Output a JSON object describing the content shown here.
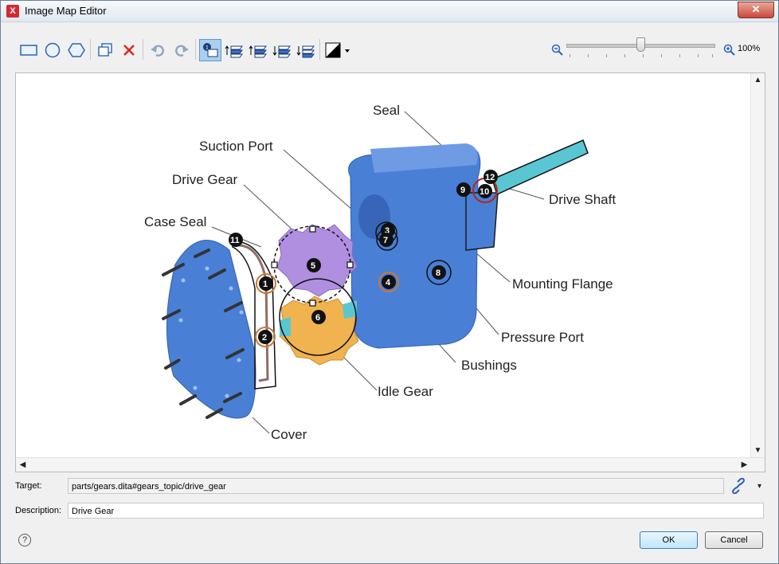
{
  "window": {
    "title": "Image Map Editor"
  },
  "toolbar": {
    "tools": [
      "rectangle-tool",
      "circle-tool",
      "polygon-tool",
      "duplicate",
      "delete",
      "undo",
      "redo",
      "show-numbers",
      "bring-to-front",
      "bring-forward",
      "send-backward",
      "send-to-back",
      "contrast"
    ],
    "zoom_label": "100%"
  },
  "diagram": {
    "labels": [
      "Seal",
      "Suction Port",
      "Drive Gear",
      "Case Seal",
      "Drive Shaft",
      "Mounting Flange",
      "Pressure Port",
      "Bushings",
      "Idle Gear",
      "Cover"
    ],
    "areas": [
      "1",
      "2",
      "3",
      "4",
      "5",
      "6",
      "7",
      "8",
      "9",
      "10",
      "11",
      "12"
    ]
  },
  "properties": {
    "target_label": "Target:",
    "target_value": "parts/gears.dita#gears_topic/drive_gear",
    "description_label": "Description:",
    "description_value": "Drive Gear"
  },
  "buttons": {
    "ok": "OK",
    "cancel": "Cancel",
    "help": "?"
  },
  "colors": {
    "accent": "#3a7fd5",
    "part_blue": "#4a7fd6",
    "gear_purple": "#b08fe0",
    "gear_orange": "#f0b34f"
  }
}
